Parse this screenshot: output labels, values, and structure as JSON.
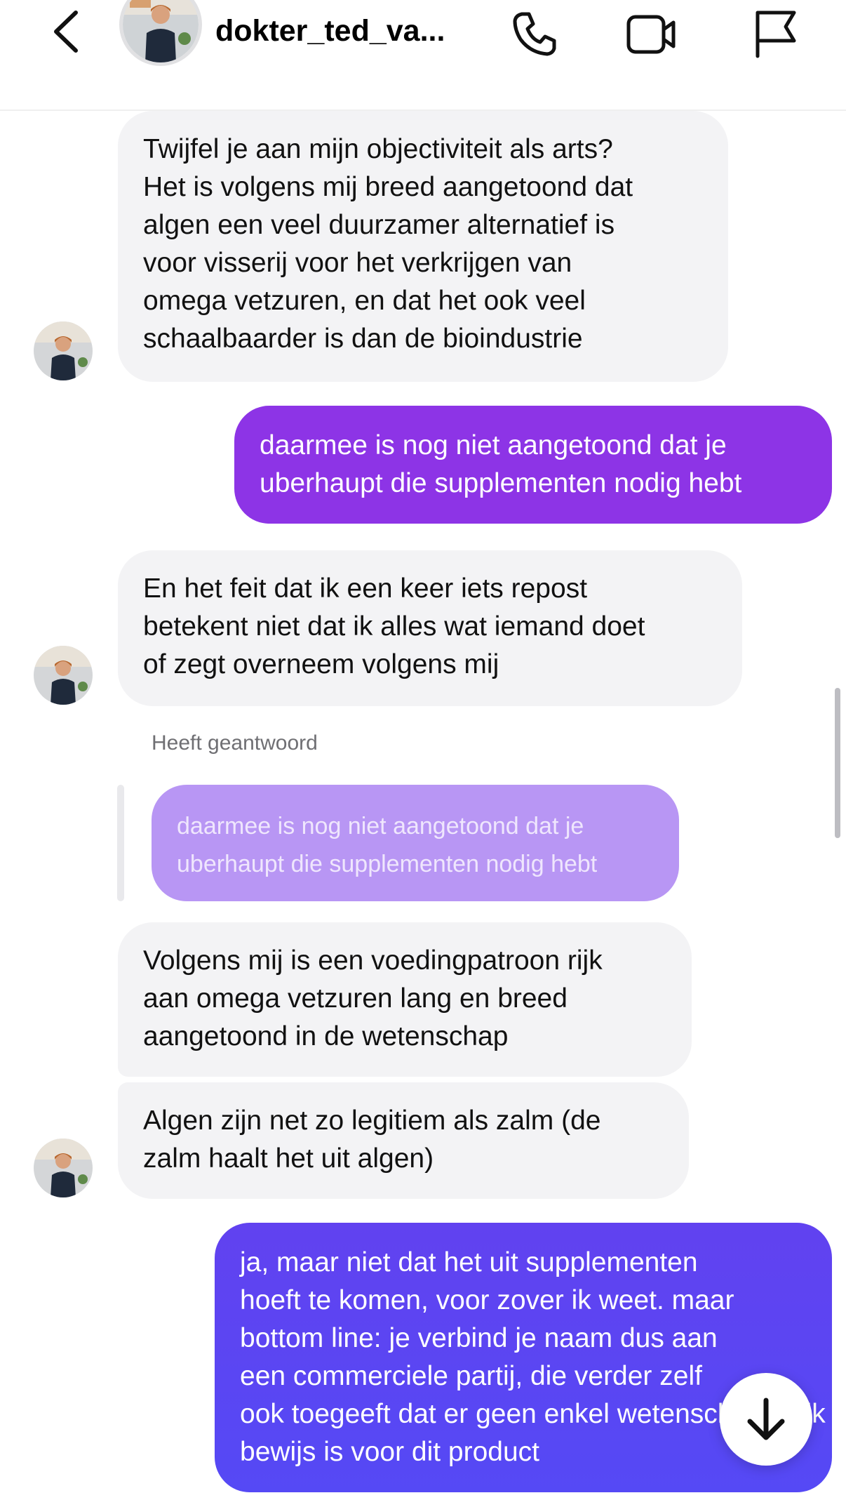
{
  "header": {
    "username": "dokter_ted_va...",
    "back_icon": "chevron-left-icon",
    "call_icon": "phone-icon",
    "video_icon": "video-camera-icon",
    "report_icon": "flag-icon"
  },
  "messages": [
    {
      "direction": "incoming",
      "lines": [
        "Twijfel je aan mijn objectiviteit als arts?",
        "Het is volgens mij breed aangetoond dat",
        "algen een veel duurzamer alternatief is",
        "voor visserij voor het verkrijgen van",
        "omega vetzuren, en dat het ook veel",
        "schaalbaarder is dan de bioindustrie"
      ]
    },
    {
      "direction": "outgoing",
      "lines": [
        "daarmee is nog niet aangetoond dat je",
        "uberhaupt die supplementen nodig hebt"
      ]
    },
    {
      "direction": "incoming",
      "lines": [
        "En het feit dat ik een keer iets repost",
        "betekent niet dat ik alles wat iemand doet",
        "of zegt overneem volgens mij"
      ]
    },
    {
      "direction": "incoming",
      "reply_label": "Heeft geantwoord",
      "quoted_lines": [
        "daarmee is nog niet aangetoond dat je",
        "uberhaupt die supplementen nodig hebt"
      ],
      "lines": [
        "Volgens mij is een voedingpatroon rijk",
        "aan omega vetzuren lang en breed",
        "aangetoond in de wetenschap"
      ]
    },
    {
      "direction": "incoming",
      "lines": [
        "Algen zijn net zo legitiem als zalm (de",
        "zalm haalt het uit algen)"
      ]
    },
    {
      "direction": "outgoing",
      "lines": [
        "ja, maar niet dat het uit supplementen",
        "hoeft te komen, voor zover ik weet. maar",
        "bottom line: je verbind je naam dus aan",
        "een commerciele partij, die verder zelf",
        "ook toegeeft dat er geen enkel wetenschappelijk",
        "bewijs is voor dit product"
      ]
    }
  ],
  "scroll_down_icon": "arrow-down-icon",
  "colors": {
    "incoming_bubble": "#f3f3f5",
    "outgoing_purple": "#8d34e6",
    "outgoing_violet": "#5a45f4",
    "quoted_bubble": "#b896f4"
  }
}
